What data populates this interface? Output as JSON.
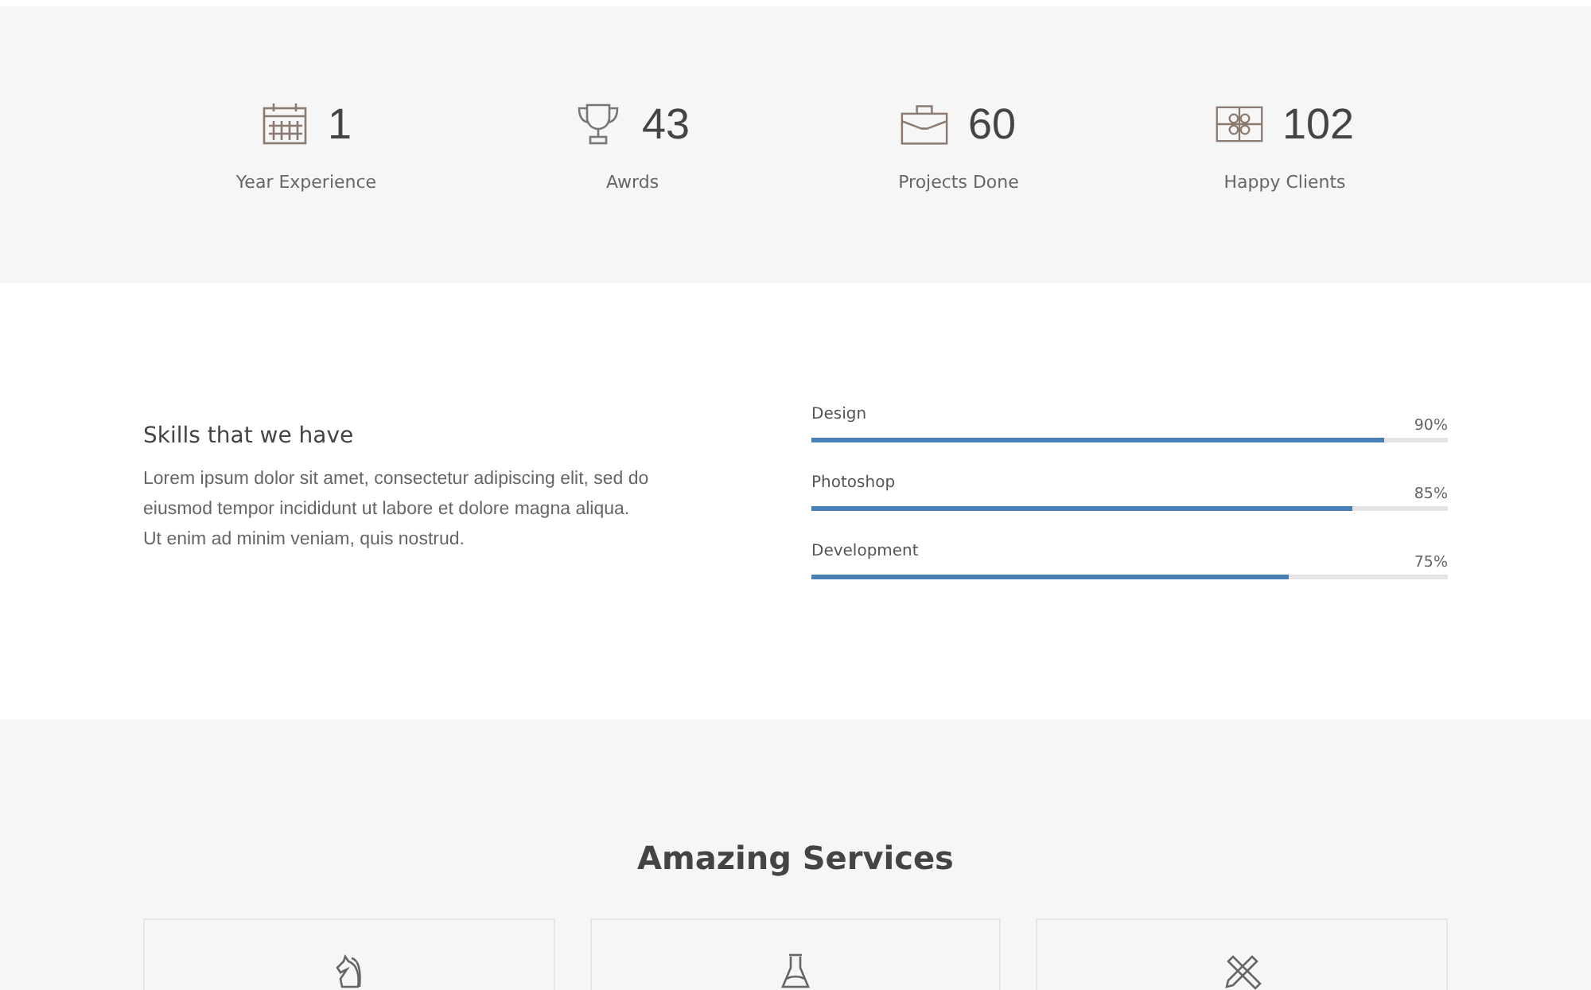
{
  "stats": [
    {
      "value": "1",
      "label": "Year Experience"
    },
    {
      "value": "43",
      "label": "Awrds"
    },
    {
      "value": "60",
      "label": "Projects Done"
    },
    {
      "value": "102",
      "label": "Happy Clients"
    }
  ],
  "skills": {
    "title": "Skills that we have",
    "text": "Lorem ipsum dolor sit amet, consectetur adipiscing elit, sed do eiusmod tempor incididunt ut labore et dolore magna aliqua. Ut enim ad minim veniam, quis nostrud.",
    "bars": [
      {
        "name": "Design",
        "reading": "90%",
        "level": 0.9
      },
      {
        "name": "Photoshop",
        "reading": "85%",
        "level": 0.85
      },
      {
        "name": "Development",
        "reading": "75%",
        "level": 0.75
      }
    ]
  },
  "services": {
    "title": "Amazing Services"
  }
}
